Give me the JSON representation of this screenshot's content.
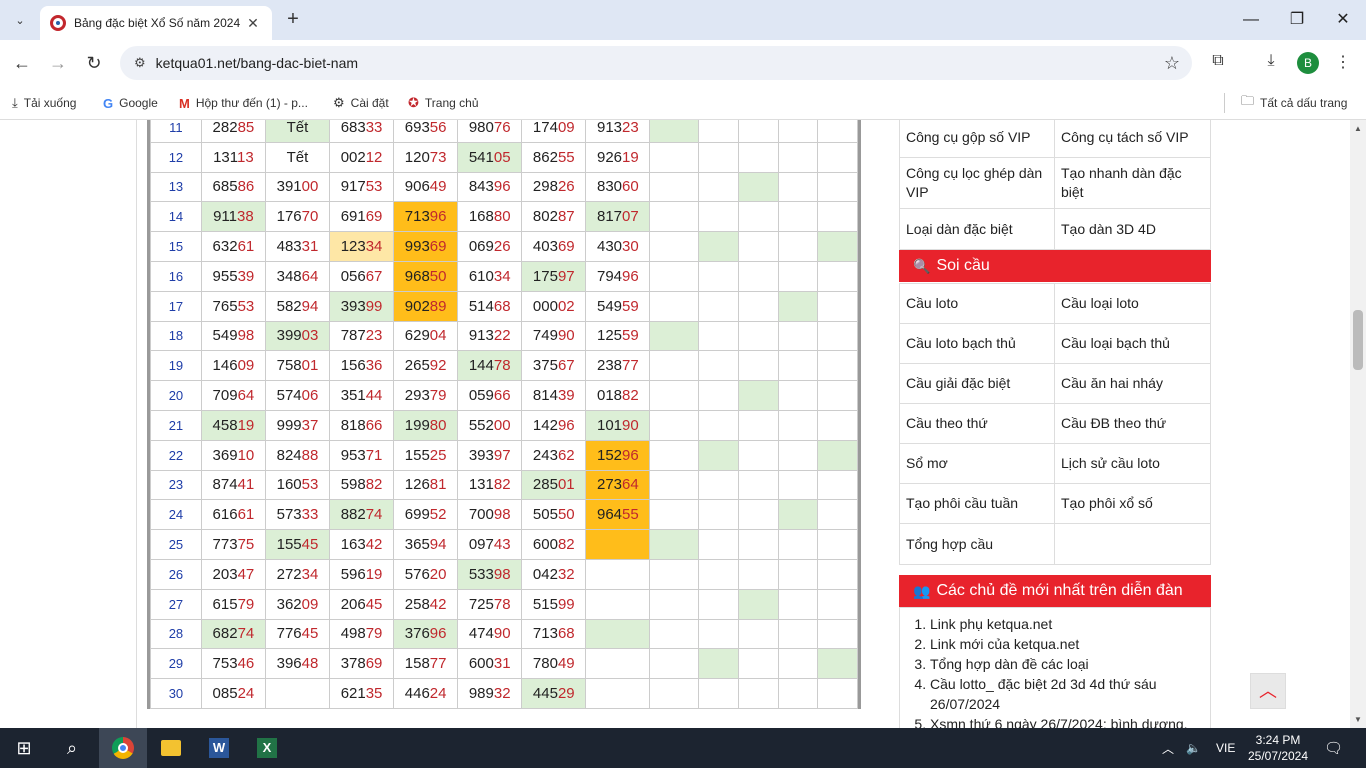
{
  "browser": {
    "tab_title": "Bảng đặc biệt Xổ Số năm 2024",
    "url": "ketqua01.net/bang-dac-biet-nam",
    "avatar_letter": "B"
  },
  "bookmarks": [
    {
      "label": "Tải xuống",
      "icon": "download-icon"
    },
    {
      "label": "Google",
      "icon": "google-icon"
    },
    {
      "label": "Hộp thư đến (1) - p...",
      "icon": "gmail-icon"
    },
    {
      "label": "Cài đặt",
      "icon": "gear-icon"
    },
    {
      "label": "Trang chủ",
      "icon": "home-logo-icon"
    }
  ],
  "all_bookmarks_label": "Tất cả dấu trang",
  "table": {
    "rows": [
      {
        "day": "11",
        "cells": [
          {
            "t": "28285",
            "s": ""
          },
          {
            "t": "Tết",
            "s": "g"
          },
          {
            "t": "68333",
            "s": ""
          },
          {
            "t": "69356",
            "s": ""
          },
          {
            "t": "98076",
            "s": ""
          },
          {
            "t": "17409",
            "s": ""
          },
          {
            "t": "91323",
            "s": ""
          }
        ],
        "extra": [
          "g",
          "",
          "",
          "",
          ""
        ]
      },
      {
        "day": "12",
        "cells": [
          {
            "t": "13113",
            "s": ""
          },
          {
            "t": "Tết",
            "s": ""
          },
          {
            "t": "00212",
            "s": ""
          },
          {
            "t": "12073",
            "s": ""
          },
          {
            "t": "54105",
            "s": "g"
          },
          {
            "t": "86255",
            "s": ""
          },
          {
            "t": "92619",
            "s": ""
          }
        ],
        "extra": [
          "",
          "",
          "",
          "",
          ""
        ]
      },
      {
        "day": "13",
        "cells": [
          {
            "t": "68586",
            "s": ""
          },
          {
            "t": "39100",
            "s": ""
          },
          {
            "t": "91753",
            "s": ""
          },
          {
            "t": "90649",
            "s": ""
          },
          {
            "t": "84396",
            "s": ""
          },
          {
            "t": "29826",
            "s": ""
          },
          {
            "t": "83060",
            "s": ""
          }
        ],
        "extra": [
          "",
          "",
          "g",
          "",
          ""
        ]
      },
      {
        "day": "14",
        "cells": [
          {
            "t": "91138",
            "s": "g"
          },
          {
            "t": "17670",
            "s": ""
          },
          {
            "t": "69169",
            "s": ""
          },
          {
            "t": "71396",
            "s": "o"
          },
          {
            "t": "16880",
            "s": ""
          },
          {
            "t": "80287",
            "s": ""
          },
          {
            "t": "81707",
            "s": "g"
          }
        ],
        "extra": [
          "",
          "",
          "",
          "",
          ""
        ]
      },
      {
        "day": "15",
        "cells": [
          {
            "t": "63261",
            "s": ""
          },
          {
            "t": "48331",
            "s": ""
          },
          {
            "t": "12334",
            "s": "y"
          },
          {
            "t": "99369",
            "s": "o"
          },
          {
            "t": "06926",
            "s": ""
          },
          {
            "t": "40369",
            "s": ""
          },
          {
            "t": "43030",
            "s": ""
          }
        ],
        "extra": [
          "",
          "g",
          "",
          "",
          "g"
        ]
      },
      {
        "day": "16",
        "cells": [
          {
            "t": "95539",
            "s": ""
          },
          {
            "t": "34864",
            "s": ""
          },
          {
            "t": "05667",
            "s": ""
          },
          {
            "t": "96850",
            "s": "o"
          },
          {
            "t": "61034",
            "s": ""
          },
          {
            "t": "17597",
            "s": "g"
          },
          {
            "t": "79496",
            "s": ""
          }
        ],
        "extra": [
          "",
          "",
          "",
          "",
          ""
        ]
      },
      {
        "day": "17",
        "cells": [
          {
            "t": "76553",
            "s": ""
          },
          {
            "t": "58294",
            "s": ""
          },
          {
            "t": "39399",
            "s": "g"
          },
          {
            "t": "90289",
            "s": "o"
          },
          {
            "t": "51468",
            "s": ""
          },
          {
            "t": "00002",
            "s": ""
          },
          {
            "t": "54959",
            "s": ""
          }
        ],
        "extra": [
          "",
          "",
          "",
          "g",
          ""
        ]
      },
      {
        "day": "18",
        "cells": [
          {
            "t": "54998",
            "s": ""
          },
          {
            "t": "39903",
            "s": "g"
          },
          {
            "t": "78723",
            "s": ""
          },
          {
            "t": "62904",
            "s": ""
          },
          {
            "t": "91322",
            "s": ""
          },
          {
            "t": "74990",
            "s": ""
          },
          {
            "t": "12559",
            "s": ""
          }
        ],
        "extra": [
          "g",
          "",
          "",
          "",
          ""
        ]
      },
      {
        "day": "19",
        "cells": [
          {
            "t": "14609",
            "s": ""
          },
          {
            "t": "75801",
            "s": ""
          },
          {
            "t": "15636",
            "s": ""
          },
          {
            "t": "26592",
            "s": ""
          },
          {
            "t": "14478",
            "s": "g"
          },
          {
            "t": "37567",
            "s": ""
          },
          {
            "t": "23877",
            "s": ""
          }
        ],
        "extra": [
          "",
          "",
          "",
          "",
          ""
        ]
      },
      {
        "day": "20",
        "cells": [
          {
            "t": "70964",
            "s": ""
          },
          {
            "t": "57406",
            "s": ""
          },
          {
            "t": "35144",
            "s": ""
          },
          {
            "t": "29379",
            "s": ""
          },
          {
            "t": "05966",
            "s": ""
          },
          {
            "t": "81439",
            "s": ""
          },
          {
            "t": "01882",
            "s": ""
          }
        ],
        "extra": [
          "",
          "",
          "g",
          "",
          ""
        ]
      },
      {
        "day": "21",
        "cells": [
          {
            "t": "45819",
            "s": "g"
          },
          {
            "t": "99937",
            "s": ""
          },
          {
            "t": "81866",
            "s": ""
          },
          {
            "t": "19980",
            "s": "g"
          },
          {
            "t": "55200",
            "s": ""
          },
          {
            "t": "14296",
            "s": ""
          },
          {
            "t": "10190",
            "s": "g"
          }
        ],
        "extra": [
          "",
          "",
          "",
          "",
          ""
        ]
      },
      {
        "day": "22",
        "cells": [
          {
            "t": "36910",
            "s": ""
          },
          {
            "t": "82488",
            "s": ""
          },
          {
            "t": "95371",
            "s": ""
          },
          {
            "t": "15525",
            "s": ""
          },
          {
            "t": "39397",
            "s": ""
          },
          {
            "t": "24362",
            "s": ""
          },
          {
            "t": "15296",
            "s": "o"
          }
        ],
        "extra": [
          "",
          "g",
          "",
          "",
          "g"
        ]
      },
      {
        "day": "23",
        "cells": [
          {
            "t": "87441",
            "s": ""
          },
          {
            "t": "16053",
            "s": ""
          },
          {
            "t": "59882",
            "s": ""
          },
          {
            "t": "12681",
            "s": ""
          },
          {
            "t": "13182",
            "s": ""
          },
          {
            "t": "28501",
            "s": "g"
          },
          {
            "t": "27364",
            "s": "o"
          }
        ],
        "extra": [
          "",
          "",
          "",
          "",
          ""
        ]
      },
      {
        "day": "24",
        "cells": [
          {
            "t": "61661",
            "s": ""
          },
          {
            "t": "57333",
            "s": ""
          },
          {
            "t": "88274",
            "s": "g"
          },
          {
            "t": "69952",
            "s": ""
          },
          {
            "t": "70098",
            "s": ""
          },
          {
            "t": "50550",
            "s": ""
          },
          {
            "t": "96455",
            "s": "o"
          }
        ],
        "extra": [
          "",
          "",
          "",
          "g",
          ""
        ]
      },
      {
        "day": "25",
        "cells": [
          {
            "t": "77375",
            "s": ""
          },
          {
            "t": "15545",
            "s": "g"
          },
          {
            "t": "16342",
            "s": ""
          },
          {
            "t": "36594",
            "s": ""
          },
          {
            "t": "09743",
            "s": ""
          },
          {
            "t": "60082",
            "s": ""
          },
          {
            "t": "",
            "s": "o"
          }
        ],
        "extra": [
          "g",
          "",
          "",
          "",
          ""
        ]
      },
      {
        "day": "26",
        "cells": [
          {
            "t": "20347",
            "s": ""
          },
          {
            "t": "27234",
            "s": ""
          },
          {
            "t": "59619",
            "s": ""
          },
          {
            "t": "57620",
            "s": ""
          },
          {
            "t": "53398",
            "s": "g"
          },
          {
            "t": "04232",
            "s": ""
          },
          {
            "t": "",
            "s": ""
          }
        ],
        "extra": [
          "",
          "",
          "",
          "",
          ""
        ]
      },
      {
        "day": "27",
        "cells": [
          {
            "t": "61579",
            "s": ""
          },
          {
            "t": "36209",
            "s": ""
          },
          {
            "t": "20645",
            "s": ""
          },
          {
            "t": "25842",
            "s": ""
          },
          {
            "t": "72578",
            "s": ""
          },
          {
            "t": "51599",
            "s": ""
          },
          {
            "t": "",
            "s": ""
          }
        ],
        "extra": [
          "",
          "",
          "g",
          "",
          ""
        ]
      },
      {
        "day": "28",
        "cells": [
          {
            "t": "68274",
            "s": "g"
          },
          {
            "t": "77645",
            "s": ""
          },
          {
            "t": "49879",
            "s": ""
          },
          {
            "t": "37696",
            "s": "g"
          },
          {
            "t": "47490",
            "s": ""
          },
          {
            "t": "71368",
            "s": ""
          },
          {
            "t": "",
            "s": "g"
          }
        ],
        "extra": [
          "",
          "",
          "",
          "",
          ""
        ]
      },
      {
        "day": "29",
        "cells": [
          {
            "t": "75346",
            "s": ""
          },
          {
            "t": "39648",
            "s": ""
          },
          {
            "t": "37869",
            "s": ""
          },
          {
            "t": "15877",
            "s": ""
          },
          {
            "t": "60031",
            "s": ""
          },
          {
            "t": "78049",
            "s": ""
          },
          {
            "t": "",
            "s": ""
          }
        ],
        "extra": [
          "",
          "g",
          "",
          "",
          "g"
        ]
      },
      {
        "day": "30",
        "cells": [
          {
            "t": "08524",
            "s": ""
          },
          {
            "t": "",
            "s": ""
          },
          {
            "t": "62135",
            "s": ""
          },
          {
            "t": "44624",
            "s": ""
          },
          {
            "t": "98932",
            "s": ""
          },
          {
            "t": "44529",
            "s": "g"
          },
          {
            "t": "",
            "s": ""
          }
        ],
        "extra": [
          "",
          "",
          "",
          "",
          ""
        ]
      }
    ]
  },
  "tools": [
    [
      "Công cụ gộp số VIP",
      "Công cụ tách số VIP"
    ],
    [
      "Công cụ lọc ghép dàn VIP",
      "Tạo nhanh dàn đặc biệt"
    ],
    [
      "Loại dàn đặc biệt",
      "Tạo dàn 3D 4D"
    ]
  ],
  "soicau": {
    "title": "Soi cầu",
    "items": [
      [
        "Cầu loto",
        "Cầu loại loto"
      ],
      [
        "Cầu loto bạch thủ",
        "Cầu loại bạch thủ"
      ],
      [
        "Cầu giải đặc biệt",
        "Cầu ăn hai nháy"
      ],
      [
        "Cầu theo thứ",
        "Cầu ĐB theo thứ"
      ],
      [
        "Sổ mơ",
        "Lịch sử cầu loto"
      ],
      [
        "Tạo phôi cầu tuần",
        "Tạo phôi xổ số"
      ],
      [
        "Tổng hợp cầu",
        ""
      ]
    ]
  },
  "forum": {
    "title": "Các chủ đề mới nhất trên diễn đàn",
    "items": [
      "Link phụ ketqua.net",
      "Link mới của ketqua.net",
      "Tổng hợp dàn đề các loại",
      "Cầu lotto_ đặc biệt 2d 3d 4d thứ sáu 26/07/2024",
      "Xsmn thứ 6 ngày 26/7/2024: bình dương,"
    ]
  },
  "taskbar": {
    "language": "VIE",
    "time": "3:24 PM",
    "date": "25/07/2024"
  },
  "colors": {
    "green_cell": "#dcefd6",
    "orange_cell": "#ffbd1a",
    "yellow_cell": "#fee7a6",
    "header_red": "#e8232c",
    "day_blue": "#1f3ea8",
    "digit_red": "#c0282d"
  }
}
